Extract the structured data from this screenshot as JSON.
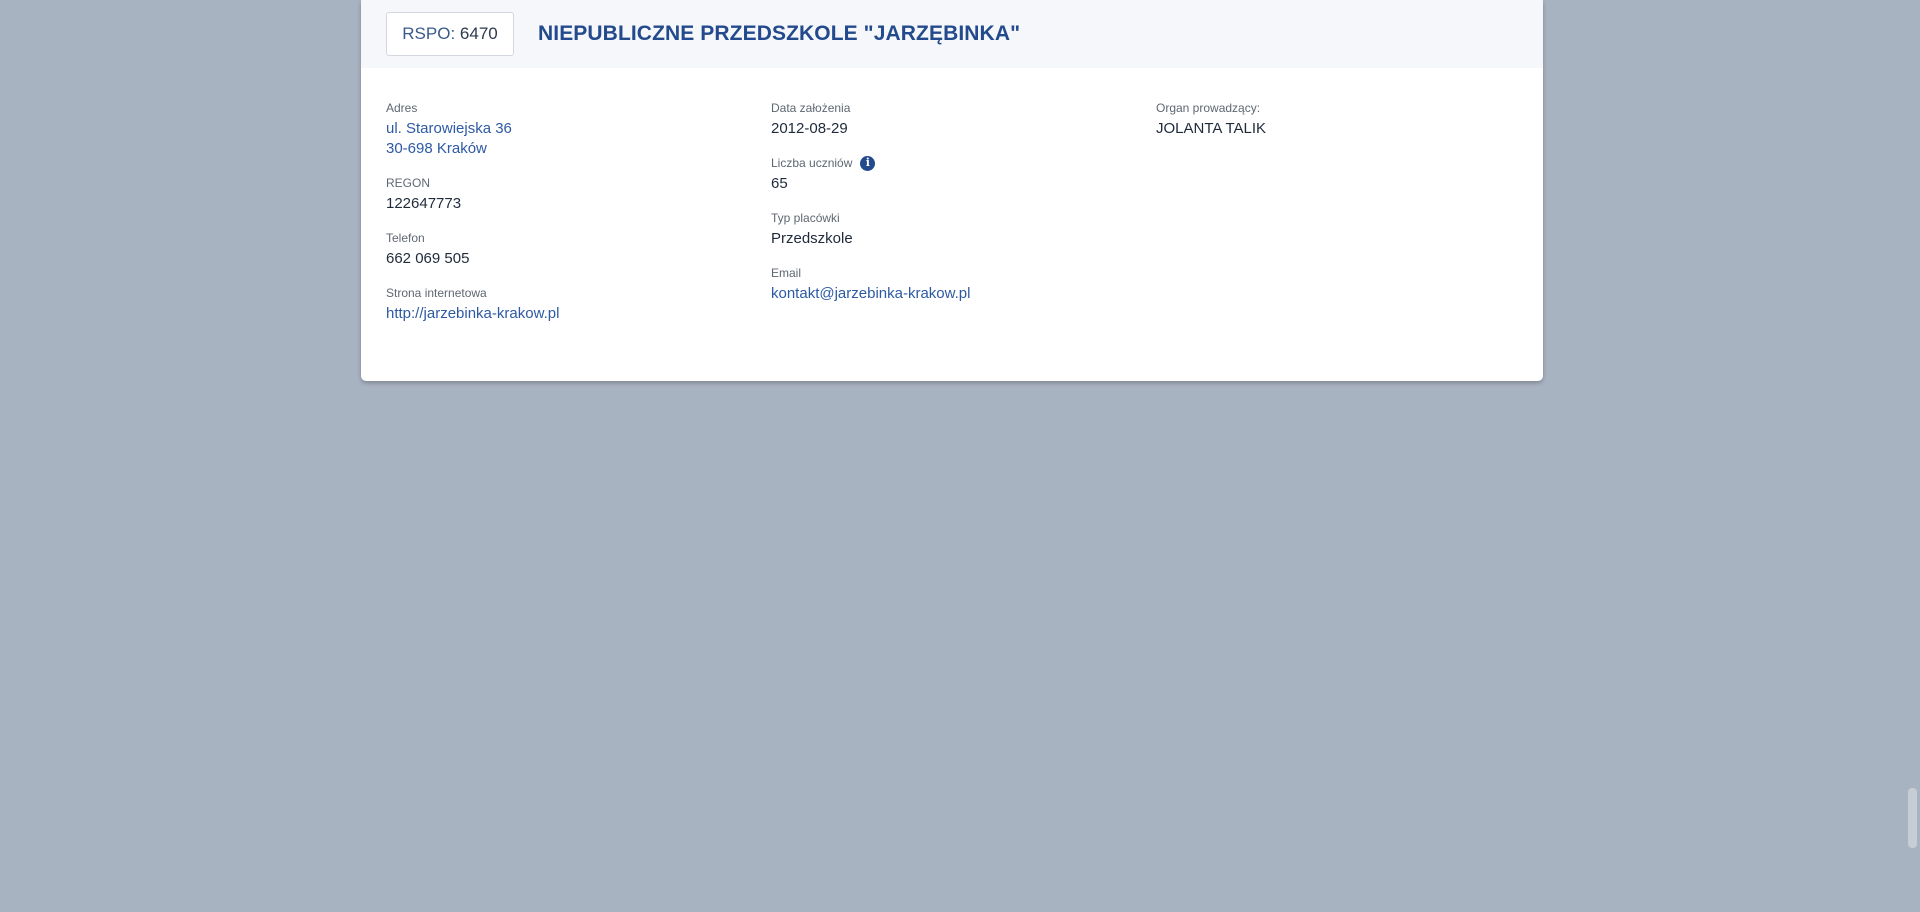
{
  "header": {
    "rspo_label": "RSPO:",
    "rspo_value": "6470",
    "school_name": "NIEPUBLICZNE PRZEDSZKOLE \"JARZĘBINKA\""
  },
  "details": {
    "address": {
      "label": "Adres",
      "line1": "ul. Starowiejska 36",
      "line2": "30-698 Kraków"
    },
    "regon": {
      "label": "REGON",
      "value": "122647773"
    },
    "phone": {
      "label": "Telefon",
      "value": "662 069 505"
    },
    "website": {
      "label": "Strona internetowa",
      "value": "http://jarzebinka-krakow.pl"
    },
    "founded": {
      "label": "Data założenia",
      "value": "2012-08-29"
    },
    "students": {
      "label": "Liczba uczniów",
      "value": "65",
      "icon": "info-icon"
    },
    "type": {
      "label": "Typ placówki",
      "value": "Przedszkole"
    },
    "email": {
      "label": "Email",
      "value": "kontakt@jarzebinka-krakow.pl"
    },
    "organ": {
      "label": "Organ prowadzący:",
      "value": "JOLANTA TALIK"
    }
  },
  "colors": {
    "background": "#a8b3c1",
    "accent": "#234a8c",
    "link": "#2d5aa3"
  }
}
